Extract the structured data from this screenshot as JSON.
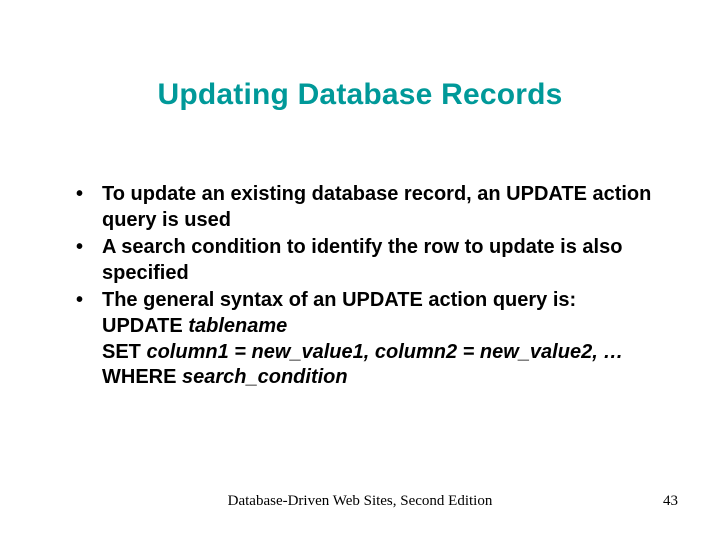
{
  "title": "Updating Database Records",
  "bullets": {
    "b1": "To update an existing database record, an UPDATE action query is used",
    "b2": "A search condition to identify the row to update is also specified",
    "b3": "The general syntax of an UPDATE action query is:",
    "b3_l1a": "UPDATE ",
    "b3_l1b": "tablename",
    "b3_l2a": "SET ",
    "b3_l2b": "column1 = new_value1, column2 = new_value2, …",
    "b3_l3a": "WHERE ",
    "b3_l3b": "search_condition"
  },
  "footer": {
    "text": "Database-Driven Web Sites, Second Edition",
    "page": "43"
  }
}
